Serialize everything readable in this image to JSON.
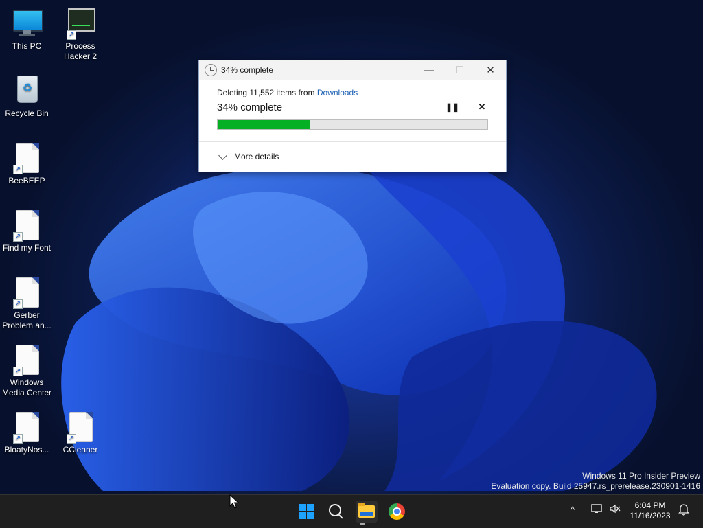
{
  "desktop": {
    "icons": [
      {
        "label": "This PC"
      },
      {
        "label": "Process Hacker 2"
      },
      {
        "label": "Recycle Bin"
      },
      {
        "label": "BeeBEEP"
      },
      {
        "label": "Find my Font"
      },
      {
        "label": "Gerber Problem an..."
      },
      {
        "label": "Windows Media Center"
      },
      {
        "label": "BloatyNos..."
      },
      {
        "label": "CCleaner"
      }
    ]
  },
  "dialog": {
    "title": "34% complete",
    "status_prefix": "Deleting 11,552 items from ",
    "status_location": "Downloads",
    "percent_text": "34% complete",
    "progress_percent": 34,
    "pause_glyph": "❚❚",
    "stop_glyph": "✕",
    "minimize_glyph": "—",
    "maximize_glyph": "☐",
    "close_glyph": "✕",
    "more_details": "More details",
    "progress_color": "#06b025"
  },
  "watermark": {
    "line1": "Windows 11 Pro Insider Preview",
    "line2": "Evaluation copy. Build 25947.rs_prerelease.230901-1416"
  },
  "taskbar": {
    "tray_chevron": "^",
    "clock_time": "6:04 PM",
    "clock_date": "11/16/2023",
    "accent": "#1ea2ff"
  }
}
